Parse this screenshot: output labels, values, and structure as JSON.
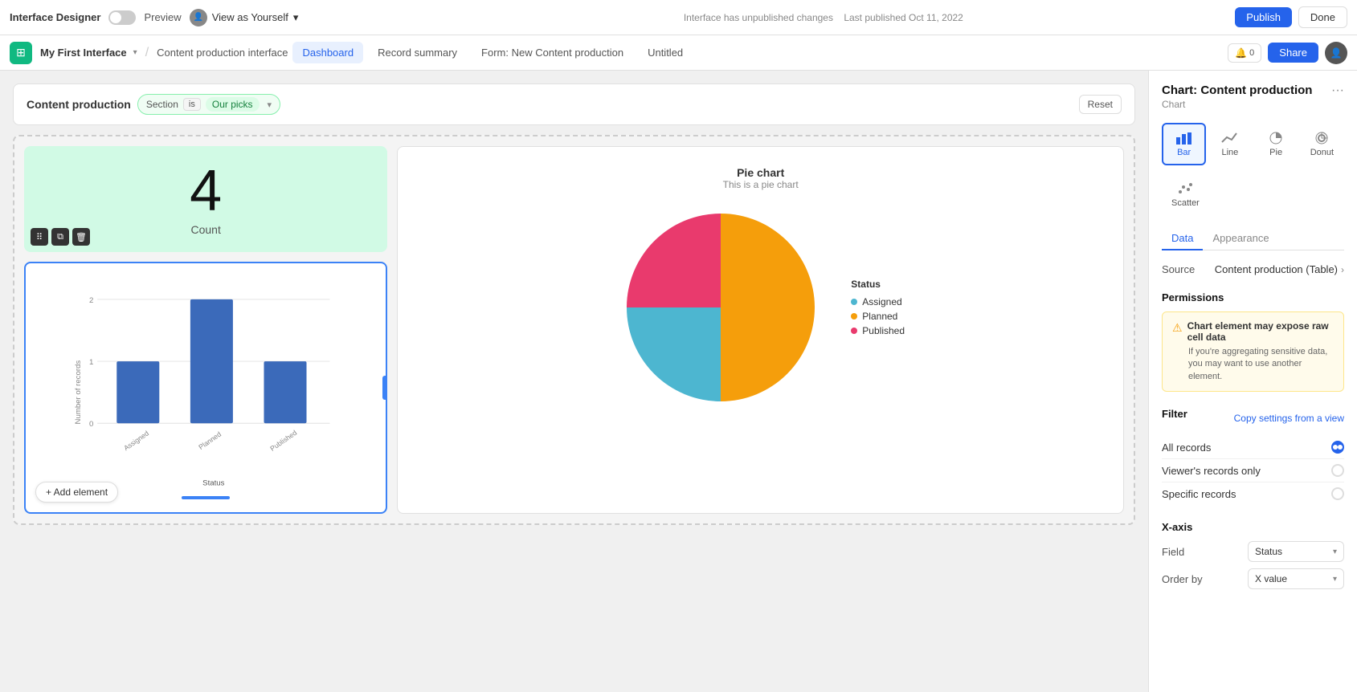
{
  "topbar": {
    "title": "Interface Designer",
    "preview_label": "Preview",
    "view_as": "View as Yourself",
    "status": "Interface has unpublished changes",
    "last_published": "Last published Oct 11, 2022",
    "publish_label": "Publish",
    "done_label": "Done"
  },
  "tabbar": {
    "app_name": "My First Interface",
    "interface_name": "Content production interface",
    "tabs": [
      {
        "id": "dashboard",
        "label": "Dashboard",
        "active": true
      },
      {
        "id": "record-summary",
        "label": "Record summary",
        "active": false
      },
      {
        "id": "form-new",
        "label": "Form: New Content production",
        "active": false
      },
      {
        "id": "untitled",
        "label": "Untitled",
        "active": false
      }
    ],
    "share_label": "Share"
  },
  "filter_bar": {
    "title": "Content production",
    "section_label": "Section",
    "is_label": "is",
    "filter_value": "Our picks",
    "reset_label": "Reset"
  },
  "count_card": {
    "number": "4",
    "label": "Count"
  },
  "bar_chart": {
    "x_axis_label": "Status",
    "y_axis_label": "Number of records",
    "bars": [
      {
        "label": "Assigned",
        "value": 1
      },
      {
        "label": "Planned",
        "value": 2
      },
      {
        "label": "Published",
        "value": 1
      }
    ],
    "y_max": 2,
    "add_element_label": "+ Add element"
  },
  "pie_chart": {
    "title": "Pie chart",
    "subtitle": "This is a pie chart",
    "legend_title": "Status",
    "legend": [
      {
        "label": "Assigned",
        "color": "#4db6d0"
      },
      {
        "label": "Planned",
        "color": "#f59e0b"
      },
      {
        "label": "Published",
        "color": "#e93a6d"
      }
    ],
    "slices": [
      {
        "label": "Planned",
        "color": "#f59e0b",
        "percent": 50,
        "start": 0,
        "end": 180
      },
      {
        "label": "Assigned",
        "color": "#4db6d0",
        "percent": 25,
        "start": 180,
        "end": 270
      },
      {
        "label": "Published",
        "color": "#e93a6d",
        "percent": 25,
        "start": 270,
        "end": 360
      }
    ]
  },
  "right_panel": {
    "title": "Chart: Content production",
    "subtitle": "Chart",
    "chart_types": [
      {
        "id": "bar",
        "label": "Bar",
        "active": true
      },
      {
        "id": "line",
        "label": "Line",
        "active": false
      },
      {
        "id": "pie",
        "label": "Pie",
        "active": false
      },
      {
        "id": "donut",
        "label": "Donut",
        "active": false
      },
      {
        "id": "scatter",
        "label": "Scatter",
        "active": false
      }
    ],
    "tabs": [
      {
        "id": "data",
        "label": "Data",
        "active": true
      },
      {
        "id": "appearance",
        "label": "Appearance",
        "active": false
      }
    ],
    "source_label": "Source",
    "source_value": "Content production (Table)",
    "permissions_title": "Permissions",
    "warning_title": "Chart element may expose raw cell data",
    "warning_text": "If you're aggregating sensitive data, you may want to use another element.",
    "filter_label": "Filter",
    "copy_settings_label": "Copy settings from a view",
    "filter_options": [
      {
        "id": "all",
        "label": "All records",
        "selected": true
      },
      {
        "id": "viewers",
        "label": "Viewer's records only",
        "selected": false
      },
      {
        "id": "specific",
        "label": "Specific records",
        "selected": false
      }
    ],
    "xaxis_label": "X-axis",
    "field_label": "Field",
    "field_value": "Status",
    "orderby_label": "Order by",
    "orderby_value": "X value"
  }
}
